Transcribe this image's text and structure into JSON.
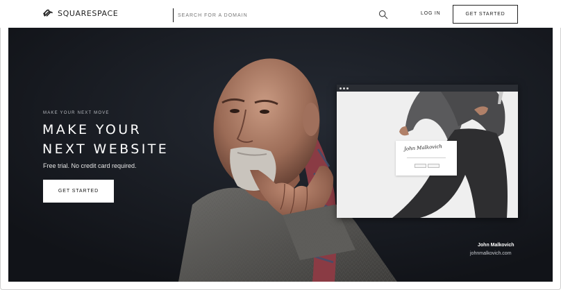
{
  "brand": {
    "name": "SQUARESPACE"
  },
  "header": {
    "search_placeholder": "SEARCH FOR A DOMAIN",
    "login_label": "LOG IN",
    "cta_label": "GET STARTED"
  },
  "hero": {
    "eyebrow": "MAKE YOUR NEXT MOVE",
    "headline_line1": "MAKE YOUR",
    "headline_line2": "NEXT WEBSITE",
    "subtext": "Free trial. No credit card required.",
    "cta_label": "GET STARTED",
    "credit_name": "John Malkovich",
    "credit_url": "johnmalkovich.com"
  },
  "mock": {
    "signature": "John Malkovich"
  },
  "colors": {
    "hero_bg": "#14171d",
    "white": "#ffffff"
  }
}
